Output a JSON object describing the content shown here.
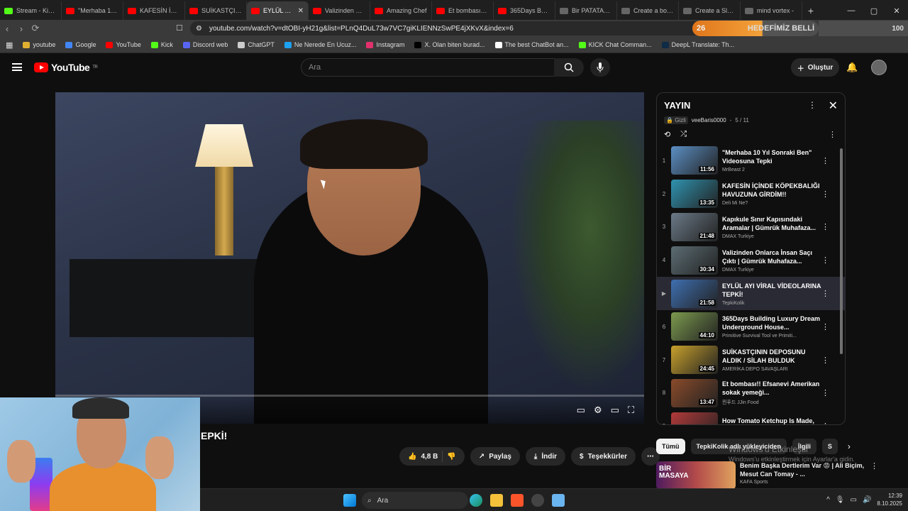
{
  "browser": {
    "tabs": [
      {
        "label": "Stream - Kick D",
        "fav": "kick"
      },
      {
        "label": "\"Merhaba 10 Y",
        "fav": "yt"
      },
      {
        "label": "KAFESİN İÇİND",
        "fav": "yt"
      },
      {
        "label": "SUİKASTÇININ",
        "fav": "yt"
      },
      {
        "label": "EYLÜL AYI",
        "fav": "yt",
        "active": true
      },
      {
        "label": "Valizinden Onla",
        "fav": "yt"
      },
      {
        "label": "Amazing Chef",
        "fav": "yt"
      },
      {
        "label": "Et bombası!! Ef",
        "fav": "yt"
      },
      {
        "label": "365Days Buildi",
        "fav": "yt"
      },
      {
        "label": "Bir PATATAS FR",
        "fav": "bk"
      },
      {
        "label": "Create a boisse",
        "fav": "bk"
      },
      {
        "label": "Create a Sleep",
        "fav": "bk"
      },
      {
        "label": "mind vortex - ",
        "fav": "bk"
      }
    ],
    "url": "youtube.com/watch?v=dtOBI-yH21g&list=PLnQ4DuL73w7VC7giKLIENNzSwPE4jXKvX&index=6",
    "extension_count": "26",
    "extension_label": "HEDEFİMİZ BELLİ",
    "extension_value": "100",
    "bookmarks": [
      {
        "label": "youtube",
        "color": "#e0b030"
      },
      {
        "label": "Google",
        "color": "#4285f4"
      },
      {
        "label": "YouTube",
        "color": "#ff0000"
      },
      {
        "label": "Kick",
        "color": "#53fc18"
      },
      {
        "label": "Discord web",
        "color": "#5865f2"
      },
      {
        "label": "ChatGPT",
        "color": "#cccccc"
      },
      {
        "label": "Ne Nerede En Ucuz...",
        "color": "#1da1f2"
      },
      {
        "label": "Instagram",
        "color": "#e1306c"
      },
      {
        "label": "X. Olan biten burad...",
        "color": "#000000"
      },
      {
        "label": "The best ChatBot an...",
        "color": "#ffffff"
      },
      {
        "label": "KICK Chat Comman...",
        "color": "#53fc18"
      },
      {
        "label": "DeepL Translate: Th...",
        "color": "#0f2b46"
      }
    ]
  },
  "youtube": {
    "logo_text": "YouTube",
    "logo_region": "TR",
    "search_placeholder": "Ara",
    "create_label": "Oluştur"
  },
  "video": {
    "title_visible": "EPKİ!",
    "likes": "4,8 B",
    "share_label": "Paylaş",
    "download_label": "İndir",
    "thanks_label": "Teşekkürler",
    "progress": 0.0
  },
  "playlist": {
    "title": "YAYIN",
    "privacy": "Gizli",
    "owner": "veeBaris0000",
    "position": "5 / 11",
    "items": [
      {
        "idx": "1",
        "title": "\"Merhaba 10 Yıl Sonraki Ben\" Videosuna Tepki",
        "channel": "MrBeast 2",
        "duration": "11:56",
        "color": "#5b8fc4"
      },
      {
        "idx": "2",
        "title": "KAFESİN İÇİNDE KÖPEKBALIĞI HAVUZUNA GİRDİM!!",
        "channel": "Deli Mi Ne?",
        "duration": "13:35",
        "color": "#2f93b0"
      },
      {
        "idx": "3",
        "title": "Kapıkule Sınır Kapısındaki Aramalar | Gümrük Muhafaza...",
        "channel": "DMAX Turkiye",
        "duration": "21:48",
        "color": "#6b7a88"
      },
      {
        "idx": "4",
        "title": "Valizinden Onlarca İnsan Saçı Çıktı | Gümrük Muhafaza...",
        "channel": "DMAX Turkiye",
        "duration": "30:34",
        "color": "#5c6d73"
      },
      {
        "idx": "▶",
        "title": "EYLÜL AYI VİRAL VİDEOLARINA TEPKİ!",
        "channel": "TepkiKolik",
        "duration": "21:58",
        "color": "#3e6fb0",
        "current": true
      },
      {
        "idx": "6",
        "title": "365Days Building Luxury Dream Underground House...",
        "channel": "Primitive Survival Tool ve Primiti...",
        "duration": "44:10",
        "color": "#7c9a4e"
      },
      {
        "idx": "7",
        "title": "SUİKASTÇININ DEPOSUNU ALDIK / SİLAH BULDUK",
        "channel": "AMERİKA DEPO SAVAŞLARI",
        "duration": "24:45",
        "color": "#c7a02c"
      },
      {
        "idx": "8",
        "title": "Et bombası!! Efsanevi Amerikan sokak yemeği...",
        "channel": "찐푸드 JJin Food",
        "duration": "13:47",
        "color": "#8a4b2a"
      },
      {
        "idx": "9",
        "title": "How Tomato Ketchup Is Made, Tomato Harvesting And...",
        "channel": "",
        "duration": "",
        "color": "#b33a3a"
      }
    ]
  },
  "chips": [
    "Tümü",
    "TepkiKolik adlı yükleyiciden",
    "İlgili",
    "S"
  ],
  "recommendation": {
    "thumb_text": "BİR MASAYA",
    "title": "Benim Başka Dertlerim Var 😡 | Ali Biçim, Mesut Can Tomay - ...",
    "channel": "KAFA Sports"
  },
  "watermark": {
    "line1": "Windows'u Etkinleştir",
    "line2": "Windows'u etkinleştirmek için Ayarlar'a gidin."
  },
  "taskbar": {
    "search_label": "Ara",
    "time": "12:39",
    "date": "8.10.2025"
  }
}
